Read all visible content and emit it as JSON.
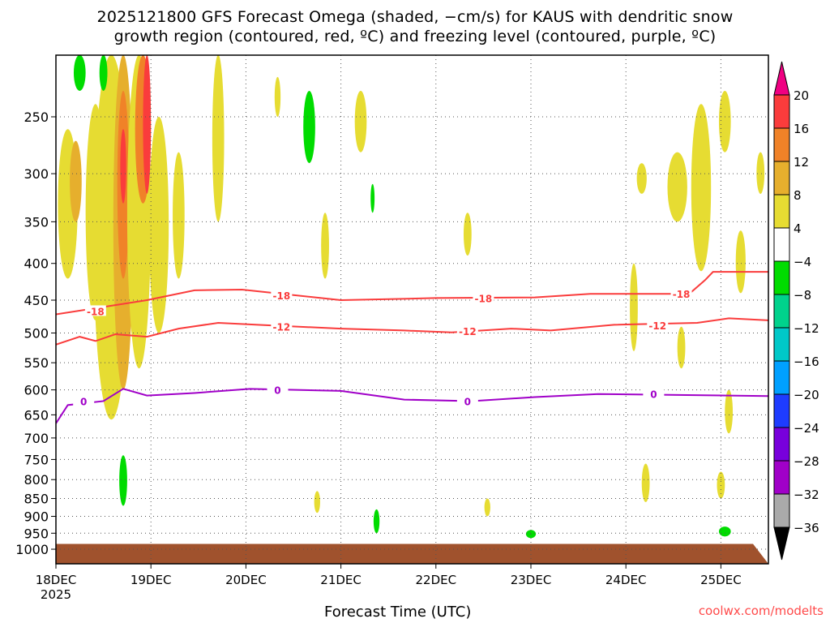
{
  "chart_data": {
    "type": "heatmap",
    "title_line1": "2025121800 GFS Forecast Omega (shaded, −cm/s) for KAUS with dendritic snow",
    "title_line2": "growth region (contoured, red, ºC) and freezing level (contoured, purple, ºC)",
    "xlabel": "Forecast Time (UTC)",
    "x_ticks": [
      {
        "hour": 0,
        "label": "18DEC",
        "sub": "2025"
      },
      {
        "hour": 24,
        "label": "19DEC"
      },
      {
        "hour": 48,
        "label": "20DEC"
      },
      {
        "hour": 72,
        "label": "21DEC"
      },
      {
        "hour": 96,
        "label": "22DEC"
      },
      {
        "hour": 120,
        "label": "23DEC"
      },
      {
        "hour": 144,
        "label": "24DEC"
      },
      {
        "hour": 168,
        "label": "25DEC"
      }
    ],
    "xlim": [
      0,
      180
    ],
    "y_ticks": [
      250,
      300,
      350,
      400,
      450,
      500,
      550,
      600,
      650,
      700,
      750,
      800,
      850,
      900,
      950,
      1000
    ],
    "ylim": [
      205,
      1040
    ],
    "grid": true,
    "colorbar": {
      "labels": [
        "20",
        "16",
        "12",
        "8",
        "4",
        "−4",
        "−8",
        "−12",
        "−16",
        "−20",
        "−24",
        "−28",
        "−32",
        "−36"
      ],
      "top_color": "#f00082",
      "bottom_color": "#000000",
      "colors": [
        "#fa3c3c",
        "#f08228",
        "#e6af2d",
        "#e6dc32",
        "#ffffff",
        "#00dc00",
        "#00d28c",
        "#00c8c8",
        "#00a0ff",
        "#1e3cff",
        "#7800dc",
        "#a000c8",
        "#aaaaaa"
      ]
    },
    "ground_color": "#a0522d",
    "shading": [
      {
        "t": 3,
        "p1": 260,
        "p2": 420,
        "w": 5,
        "c": "#e6dc32"
      },
      {
        "t": 5,
        "p1": 270,
        "p2": 350,
        "w": 3,
        "c": "#e6af2d"
      },
      {
        "t": 10,
        "p1": 240,
        "p2": 480,
        "w": 5,
        "c": "#e6dc32"
      },
      {
        "t": 14,
        "p1": 205,
        "p2": 660,
        "w": 9,
        "c": "#e6dc32"
      },
      {
        "t": 17,
        "p1": 205,
        "p2": 600,
        "w": 5,
        "c": "#e6af2d"
      },
      {
        "t": 17,
        "p1": 230,
        "p2": 420,
        "w": 3,
        "c": "#f08228"
      },
      {
        "t": 17,
        "p1": 260,
        "p2": 330,
        "w": 1.5,
        "c": "#fa3c3c"
      },
      {
        "t": 21,
        "p1": 205,
        "p2": 560,
        "w": 6,
        "c": "#e6dc32"
      },
      {
        "t": 22,
        "p1": 205,
        "p2": 330,
        "w": 4,
        "c": "#f08228"
      },
      {
        "t": 23,
        "p1": 205,
        "p2": 320,
        "w": 2,
        "c": "#fa3c3c"
      },
      {
        "t": 26,
        "p1": 250,
        "p2": 500,
        "w": 5,
        "c": "#e6dc32"
      },
      {
        "t": 31,
        "p1": 280,
        "p2": 420,
        "w": 3,
        "c": "#e6dc32"
      },
      {
        "t": 6,
        "p1": 205,
        "p2": 230,
        "w": 3,
        "c": "#00dc00"
      },
      {
        "t": 12,
        "p1": 205,
        "p2": 230,
        "w": 2,
        "c": "#00dc00"
      },
      {
        "t": 17,
        "p1": 740,
        "p2": 870,
        "w": 2,
        "c": "#00dc00"
      },
      {
        "t": 41,
        "p1": 205,
        "p2": 350,
        "w": 3,
        "c": "#e6dc32"
      },
      {
        "t": 56,
        "p1": 220,
        "p2": 250,
        "w": 1.5,
        "c": "#e6dc32"
      },
      {
        "t": 64,
        "p1": 230,
        "p2": 290,
        "w": 3,
        "c": "#00dc00"
      },
      {
        "t": 68,
        "p1": 340,
        "p2": 420,
        "w": 2,
        "c": "#e6dc32"
      },
      {
        "t": 66,
        "p1": 830,
        "p2": 890,
        "w": 1.5,
        "c": "#e6dc32"
      },
      {
        "t": 77,
        "p1": 230,
        "p2": 280,
        "w": 3,
        "c": "#e6dc32"
      },
      {
        "t": 80,
        "p1": 310,
        "p2": 340,
        "w": 1,
        "c": "#00dc00"
      },
      {
        "t": 81,
        "p1": 880,
        "p2": 950,
        "w": 1.5,
        "c": "#00dc00"
      },
      {
        "t": 104,
        "p1": 340,
        "p2": 390,
        "w": 2,
        "c": "#e6dc32"
      },
      {
        "t": 109,
        "p1": 850,
        "p2": 900,
        "w": 1.5,
        "c": "#e6dc32"
      },
      {
        "t": 120,
        "p1": 940,
        "p2": 965,
        "w": 2.5,
        "c": "#00dc00"
      },
      {
        "t": 146,
        "p1": 400,
        "p2": 530,
        "w": 2,
        "c": "#e6dc32"
      },
      {
        "t": 148,
        "p1": 290,
        "p2": 320,
        "w": 2.5,
        "c": "#e6dc32"
      },
      {
        "t": 149,
        "p1": 760,
        "p2": 860,
        "w": 2,
        "c": "#e6dc32"
      },
      {
        "t": 157,
        "p1": 280,
        "p2": 350,
        "w": 5,
        "c": "#e6dc32"
      },
      {
        "t": 158,
        "p1": 490,
        "p2": 560,
        "w": 2,
        "c": "#e6dc32"
      },
      {
        "t": 163,
        "p1": 240,
        "p2": 410,
        "w": 5,
        "c": "#e6dc32"
      },
      {
        "t": 169,
        "p1": 230,
        "p2": 280,
        "w": 3,
        "c": "#e6dc32"
      },
      {
        "t": 168,
        "p1": 780,
        "p2": 850,
        "w": 2,
        "c": "#e6dc32"
      },
      {
        "t": 169,
        "p1": 930,
        "p2": 960,
        "w": 3,
        "c": "#00dc00"
      },
      {
        "t": 173,
        "p1": 360,
        "p2": 440,
        "w": 2.5,
        "c": "#e6dc32"
      },
      {
        "t": 170,
        "p1": 600,
        "p2": 690,
        "w": 2,
        "c": "#e6dc32"
      },
      {
        "t": 178,
        "p1": 280,
        "p2": 320,
        "w": 2,
        "c": "#e6dc32"
      }
    ],
    "contours": [
      {
        "level": "-18",
        "color": "#fa3c3c",
        "points": [
          [
            0,
            471
          ],
          [
            23,
            450
          ],
          [
            35,
            436
          ],
          [
            47,
            435
          ],
          [
            72,
            450
          ],
          [
            96,
            447
          ],
          [
            121,
            446
          ],
          [
            135,
            441
          ],
          [
            160,
            441
          ],
          [
            164,
            422
          ],
          [
            166,
            411
          ],
          [
            180,
            411
          ]
        ],
        "labels": [
          [
            10,
            466
          ],
          [
            57,
            443
          ],
          [
            108,
            447
          ],
          [
            158,
            441
          ]
        ]
      },
      {
        "level": "-12",
        "color": "#fa3c3c",
        "points": [
          [
            0,
            519
          ],
          [
            6,
            506
          ],
          [
            10,
            513
          ],
          [
            15,
            502
          ],
          [
            23,
            506
          ],
          [
            31,
            493
          ],
          [
            41,
            484
          ],
          [
            51,
            487
          ],
          [
            72,
            493
          ],
          [
            88,
            496
          ],
          [
            100,
            499
          ],
          [
            115,
            493
          ],
          [
            125,
            496
          ],
          [
            141,
            487
          ],
          [
            162,
            484
          ],
          [
            170,
            477
          ],
          [
            180,
            480
          ]
        ],
        "labels": [
          [
            57,
            490
          ],
          [
            104,
            497
          ],
          [
            152,
            488
          ]
        ]
      },
      {
        "level": "0",
        "color": "#a000c8",
        "points": [
          [
            0,
            668
          ],
          [
            3,
            630
          ],
          [
            12,
            622
          ],
          [
            17,
            598
          ],
          [
            23,
            611
          ],
          [
            35,
            606
          ],
          [
            49,
            598
          ],
          [
            72,
            602
          ],
          [
            88,
            619
          ],
          [
            105,
            622
          ],
          [
            121,
            614
          ],
          [
            137,
            608
          ],
          [
            170,
            611
          ],
          [
            180,
            612
          ]
        ],
        "labels": [
          [
            7,
            622
          ],
          [
            56,
            600
          ],
          [
            104,
            622
          ],
          [
            151,
            608
          ]
        ]
      }
    ]
  },
  "credit": "coolwx.com/modelts"
}
